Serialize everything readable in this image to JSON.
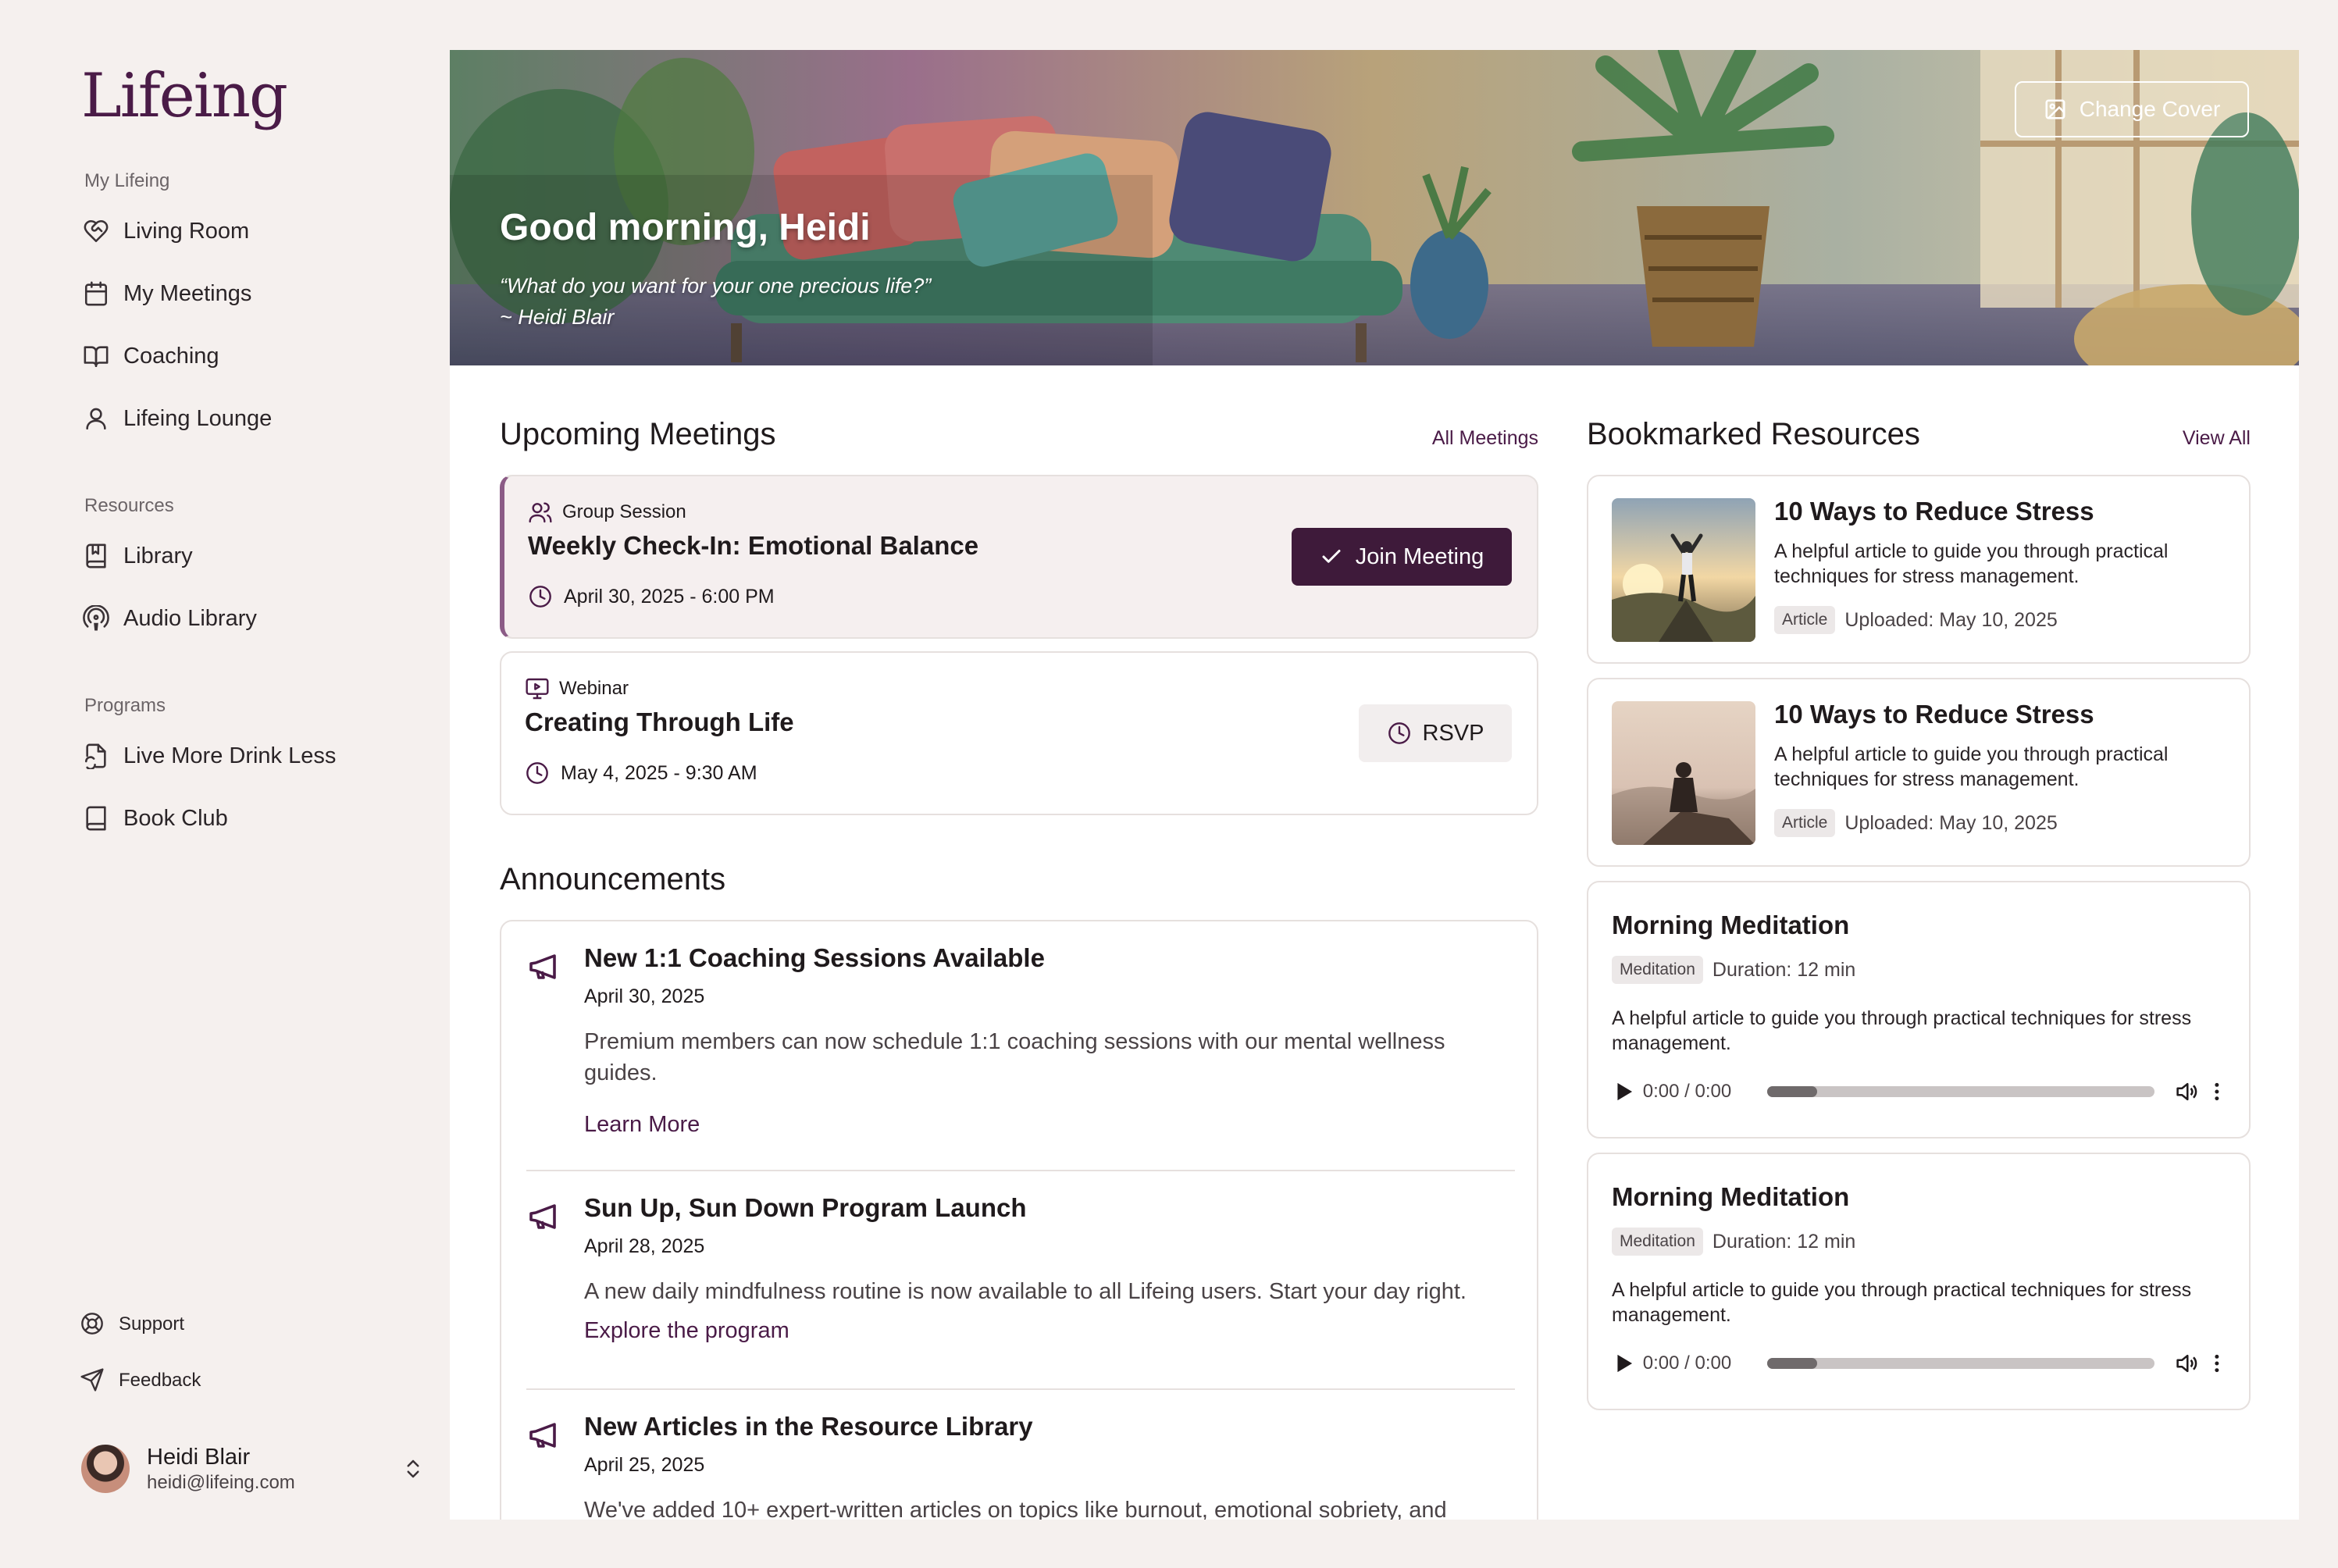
{
  "brand": {
    "logo_text": "Lifeing"
  },
  "sidebar": {
    "sections": [
      {
        "label": "My Lifeing"
      },
      {
        "label": "Resources"
      },
      {
        "label": "Programs"
      }
    ],
    "items": [
      {
        "label": "Living Room",
        "icon": "heart-handshake-icon"
      },
      {
        "label": "My Meetings",
        "icon": "calendar-icon"
      },
      {
        "label": "Coaching",
        "icon": "book-open-icon"
      },
      {
        "label": "Lifeing Lounge",
        "icon": "user-icon"
      },
      {
        "label": "Library",
        "icon": "bookmark-book-icon"
      },
      {
        "label": "Audio Library",
        "icon": "podcast-icon"
      },
      {
        "label": "Live More Drink Less",
        "icon": "file-sync-icon"
      },
      {
        "label": "Book Club",
        "icon": "book-icon"
      }
    ],
    "footer": [
      {
        "label": "Support",
        "icon": "lifebuoy-icon"
      },
      {
        "label": "Feedback",
        "icon": "send-icon"
      }
    ],
    "user": {
      "name": "Heidi Blair",
      "email": "heidi@lifeing.com"
    }
  },
  "hero": {
    "greeting": "Good morning, Heidi",
    "quote": "“What do you want for your one precious life?”",
    "quote_author": "~ Heidi Blair",
    "change_cover_label": "Change Cover"
  },
  "meetings": {
    "title": "Upcoming Meetings",
    "link": "All Meetings",
    "items": [
      {
        "type": "Group Session",
        "title": "Weekly Check-In: Emotional Balance",
        "time": "April 30, 2025 - 6:00 PM",
        "action": "Join Meeting"
      },
      {
        "type": "Webinar",
        "title": "Creating Through Life",
        "time": "May 4, 2025 - 9:30 AM",
        "action": "RSVP"
      }
    ]
  },
  "announcements": {
    "title": "Announcements",
    "items": [
      {
        "title": "New 1:1 Coaching Sessions Available",
        "date": "April 30, 2025",
        "body": "Premium members can now schedule 1:1 coaching sessions with our mental wellness guides.",
        "link": "Learn More"
      },
      {
        "title": "Sun Up, Sun Down Program Launch",
        "date": "April 28, 2025",
        "body": "A new daily mindfulness routine is now available to all Lifeing users. Start your day right.",
        "link": "Explore the program"
      },
      {
        "title": "New Articles in the Resource Library",
        "date": "April 25, 2025",
        "body": "We've added 10+ expert-written articles on topics like burnout, emotional sobriety, and"
      }
    ]
  },
  "resources": {
    "title": "Bookmarked Resources",
    "link": "View All",
    "articles": [
      {
        "title": "10 Ways to Reduce Stress",
        "description": "A helpful article to guide you through practical techniques for stress management.",
        "tag": "Article",
        "uploaded": "Uploaded: May 10, 2025"
      },
      {
        "title": "10 Ways to Reduce Stress",
        "description": "A helpful article to guide you through practical techniques for stress management.",
        "tag": "Article",
        "uploaded": "Uploaded: May 10, 2025"
      }
    ],
    "audios": [
      {
        "title": "Morning Meditation",
        "tag": "Meditation",
        "duration": "Duration: 12 min",
        "description": "A helpful article to guide you through practical techniques for stress management.",
        "time": "0:00 / 0:00",
        "progress": 0.13
      },
      {
        "title": "Morning Meditation",
        "tag": "Meditation",
        "duration": "Duration: 12 min",
        "description": "A helpful article to guide you through practical techniques for stress management.",
        "time": "0:00 / 0:00",
        "progress": 0.13
      }
    ]
  },
  "colors": {
    "accent": "#3e1a3a",
    "link": "#4a1b47",
    "sidebar_bg": "#f5f0ee"
  }
}
